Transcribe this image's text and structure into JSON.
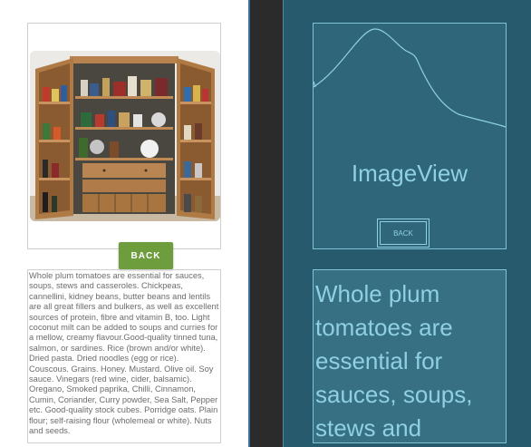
{
  "design": {
    "image_alt": "Wooden pantry cabinet with open doors stocked with jars and food",
    "back_label": "BACK",
    "body_text": "Whole plum tomatoes are essential for sauces, soups, stews and casseroles. Chickpeas, cannellini, kidney beans, butter beans and lentils are all great fillers and bulkers, as well as excellent sources of protein, fibre and vitamin B, too. Light coconut milt can be added to soups and curries for a mellow, creamy flavour.Good-quality tinned tuna, salmon, or sardines. Rice (brown and/or white). Dried pasta. Dried noodles (egg or rice). Couscous. Grains. Honey. Mustard. Olive oil. Soy sauce. Vinegars (red wine, cider, balsamic). Oregano, Smoked paprika, Chilli, Cinnamon, Cumin, Coriander, Curry powder, Sea Salt, Pepper etc. Good-quality stock cubes. Porridge oats. Plain flour; self-raising flour (wholemeal or white). Nuts and seeds."
  },
  "blueprint": {
    "imageview_label": "ImageView",
    "back_label": "BACK",
    "body_text": "Whole plum tomatoes are essential for sauces, soups, stews and"
  },
  "colors": {
    "back_button": "#6e9d3e",
    "blueprint_bg": "#275a6c",
    "blueprint_line": "#8fd0e4",
    "divider": "#2b2b2b"
  }
}
